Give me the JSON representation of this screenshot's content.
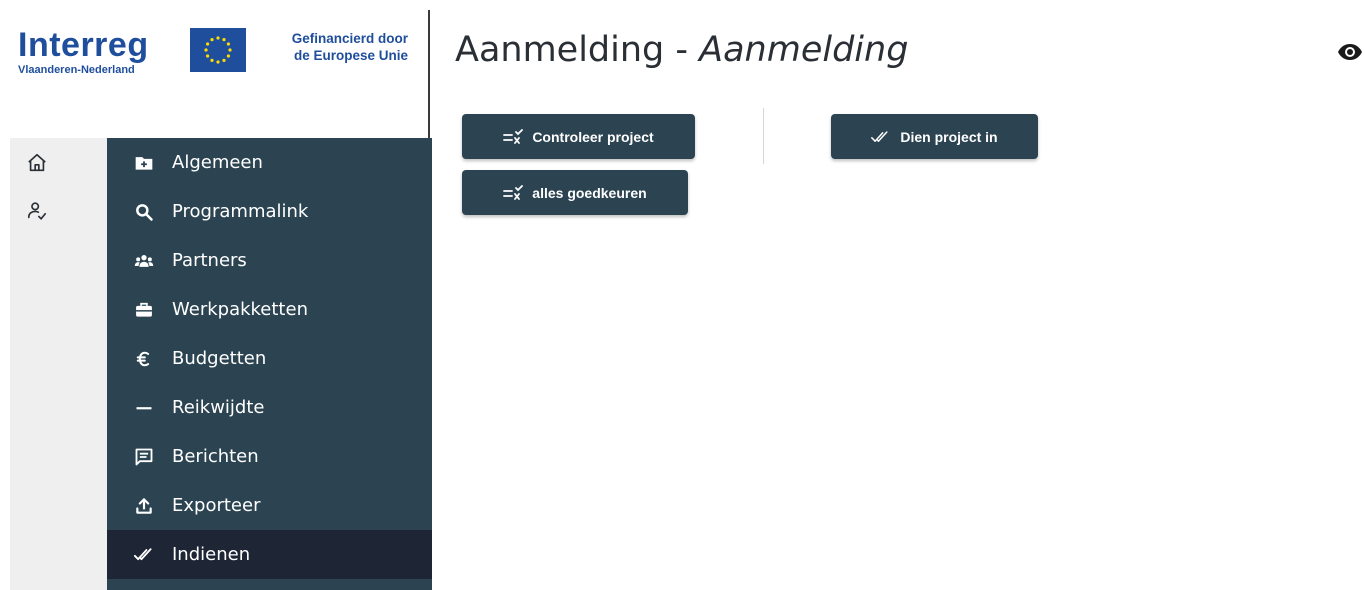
{
  "branding": {
    "logo_word": "Interreg",
    "logo_sub": "Vlaanderen-Nederland",
    "eu_line1": "Gefinancierd door",
    "eu_line2": "de Europese Unie"
  },
  "rail": {
    "items": [
      {
        "icon": "home-icon"
      },
      {
        "icon": "user-check-icon"
      }
    ]
  },
  "nav": {
    "items": [
      {
        "label": "Algemeen",
        "icon": "folder-plus-icon"
      },
      {
        "label": "Programmalink",
        "icon": "search-icon"
      },
      {
        "label": "Partners",
        "icon": "users-icon"
      },
      {
        "label": "Werkpakketten",
        "icon": "briefcase-icon"
      },
      {
        "label": "Budgetten",
        "icon": "euro-icon"
      },
      {
        "label": "Reikwijdte",
        "icon": "minus-icon"
      },
      {
        "label": "Berichten",
        "icon": "message-icon"
      },
      {
        "label": "Exporteer",
        "icon": "upload-icon"
      },
      {
        "label": "Indienen",
        "icon": "double-check-icon",
        "active": true
      }
    ]
  },
  "header": {
    "title_prefix": "Aanmelding - ",
    "title_italic": "Aanmelding"
  },
  "actions": {
    "check_project": "Controleer project",
    "approve_all": "alles goedkeuren",
    "submit_project": "Dien project in"
  },
  "colors": {
    "nav_bg": "#2c4452",
    "nav_active_bg": "#1e2535",
    "brand_blue": "#1f4e9c",
    "button_bg": "#2c4452"
  }
}
